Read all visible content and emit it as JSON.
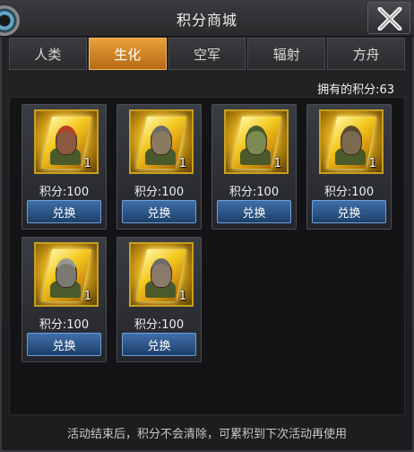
{
  "header": {
    "title": "积分商城"
  },
  "tabs": [
    {
      "label": "人类",
      "active": false
    },
    {
      "label": "生化",
      "active": true
    },
    {
      "label": "空军",
      "active": false
    },
    {
      "label": "辐射",
      "active": false
    },
    {
      "label": "方舟",
      "active": false
    }
  ],
  "points_label": "拥有的积分:63",
  "items": [
    {
      "qty": "1",
      "price": "积分:100",
      "button": "兑换",
      "skin": "#8a5a40",
      "hair": "#b8402a"
    },
    {
      "qty": "1",
      "price": "积分:100",
      "button": "兑换",
      "skin": "#8a7a60",
      "hair": "#6a6a6a"
    },
    {
      "qty": "1",
      "price": "积分:100",
      "button": "兑换",
      "skin": "#7a8a50",
      "hair": "#4a5a30"
    },
    {
      "qty": "1",
      "price": "积分:100",
      "button": "兑换",
      "skin": "#7a6a50",
      "hair": "#5a4a30"
    },
    {
      "qty": "1",
      "price": "积分:100",
      "button": "兑换",
      "skin": "#7a7a70",
      "hair": "#9a9a90"
    },
    {
      "qty": "1",
      "price": "积分:100",
      "button": "兑换",
      "skin": "#8a7a6a",
      "hair": "#6a6a6a"
    }
  ],
  "footer": "活动结束后，积分不会清除，可累积到下次活动再使用",
  "colors": {
    "accent": "#e8a13a",
    "button": "#2a5488",
    "item_bg": "#d8a418"
  }
}
